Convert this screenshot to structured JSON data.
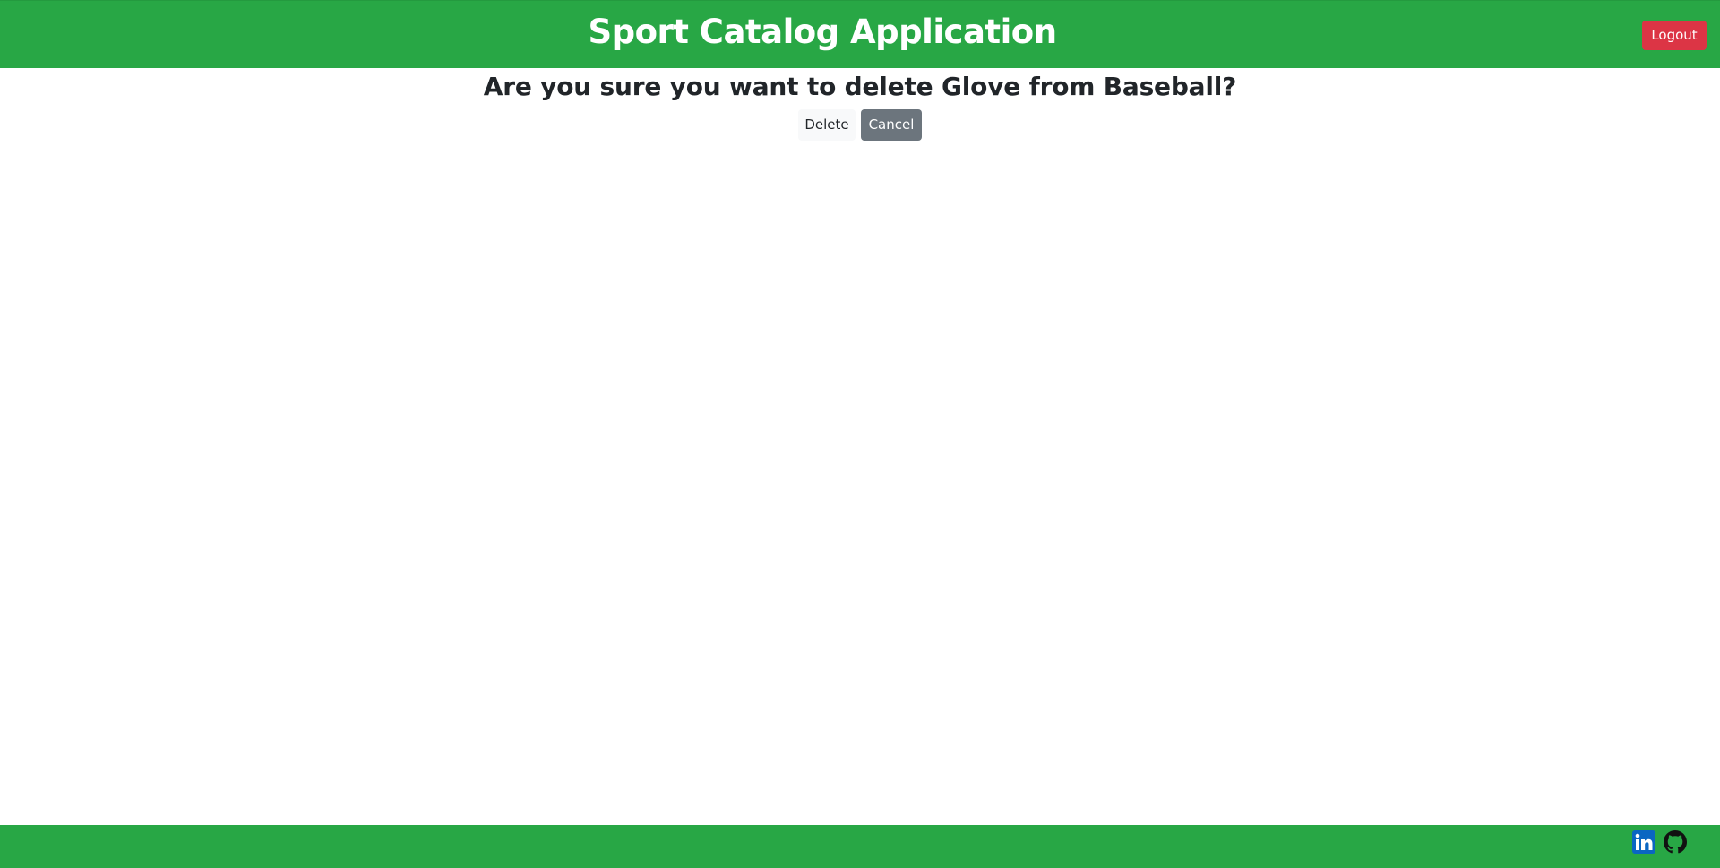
{
  "header": {
    "title": "Sport Catalog Application",
    "logout_label": "Logout"
  },
  "confirm": {
    "message": "Are you sure you want to delete Glove from Baseball?",
    "delete_label": "Delete",
    "cancel_label": "Cancel"
  },
  "footer": {
    "links": [
      {
        "icon": "linkedin-icon"
      },
      {
        "icon": "github-icon"
      }
    ]
  },
  "colors": {
    "brand_green": "#28a745",
    "danger": "#dc3545",
    "secondary": "#6c757d",
    "light": "#f8f9fa",
    "linkedin_blue": "#0a66c2"
  }
}
